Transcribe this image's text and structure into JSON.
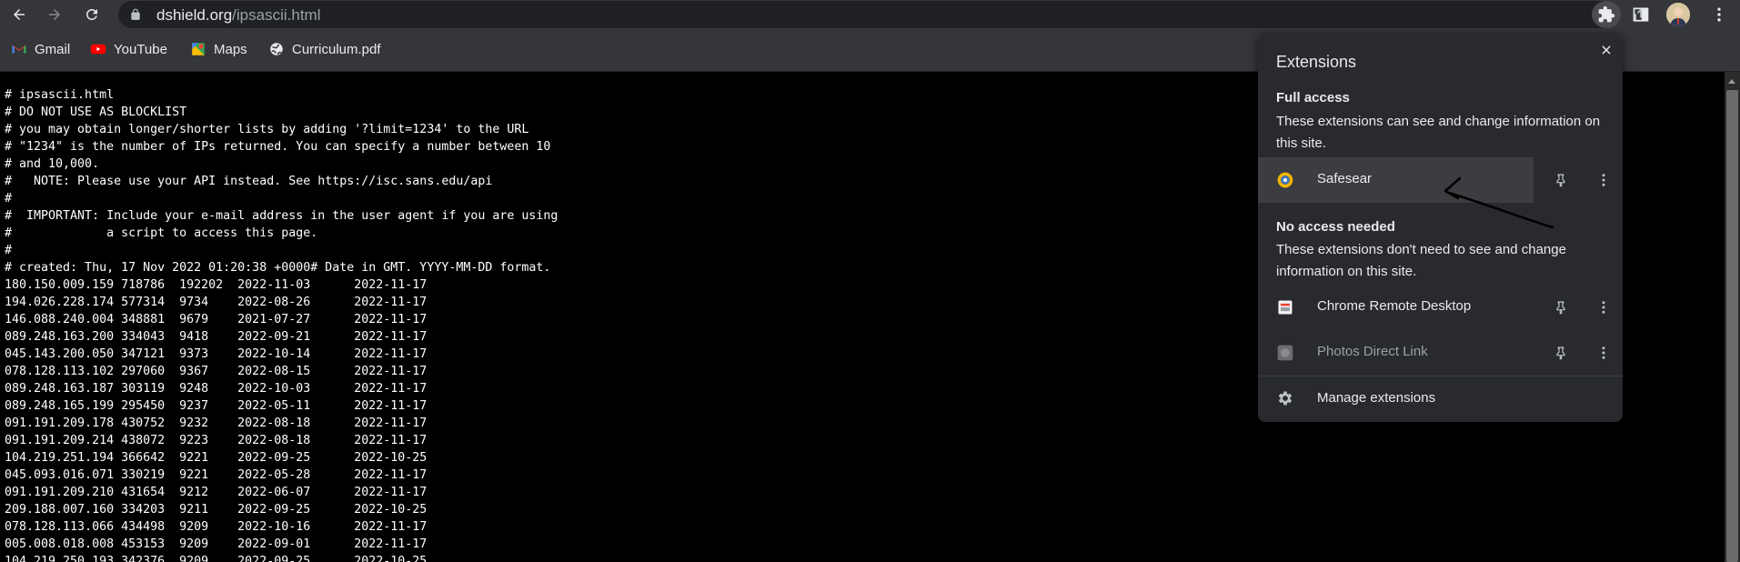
{
  "toolbar": {
    "url_host": "dshield.org",
    "url_path": "/ipsascii.html"
  },
  "bookmarks": [
    {
      "label": "Gmail",
      "icon": "gmail-icon"
    },
    {
      "label": "YouTube",
      "icon": "youtube-icon"
    },
    {
      "label": "Maps",
      "icon": "maps-icon"
    },
    {
      "label": "Curriculum.pdf",
      "icon": "globe-icon"
    }
  ],
  "page": {
    "lines": [
      "# ipsascii.html",
      "# DO NOT USE AS BLOCKLIST",
      "# you may obtain longer/shorter lists by adding '?limit=1234' to the URL",
      "# \"1234\" is the number of IPs returned. You can specify a number between 10",
      "# and 10,000.",
      "#   NOTE: Please use your API instead. See https://isc.sans.edu/api",
      "#",
      "#  IMPORTANT: Include your e-mail address in the user agent if you are using",
      "#             a script to access this page.",
      "#",
      "# created: Thu, 17 Nov 2022 01:20:38 +0000# Date in GMT. YYYY-MM-DD format.",
      "180.150.009.159 718786  192202  2022-11-03      2022-11-17",
      "194.026.228.174 577314  9734    2022-08-26      2022-11-17",
      "146.088.240.004 348881  9679    2021-07-27      2022-11-17",
      "089.248.163.200 334043  9418    2022-09-21      2022-11-17",
      "045.143.200.050 347121  9373    2022-10-14      2022-11-17",
      "078.128.113.102 297060  9367    2022-08-15      2022-11-17",
      "089.248.163.187 303119  9248    2022-10-03      2022-11-17",
      "089.248.165.199 295450  9237    2022-05-11      2022-11-17",
      "091.191.209.178 430752  9232    2022-08-18      2022-11-17",
      "091.191.209.214 438072  9223    2022-08-18      2022-11-17",
      "104.219.251.194 366642  9221    2022-09-25      2022-10-25",
      "045.093.016.071 330219  9221    2022-05-28      2022-11-17",
      "091.191.209.210 431654  9212    2022-06-07      2022-11-17",
      "209.188.007.160 334203  9211    2022-09-25      2022-10-25",
      "078.128.113.066 434498  9209    2022-10-16      2022-11-17",
      "005.008.018.008 453153  9209    2022-09-01      2022-11-17",
      "104.219.250.193 342376  9209    2022-09-25      2022-10-25"
    ]
  },
  "extensions_popup": {
    "title": "Extensions",
    "full_access": {
      "heading": "Full access",
      "description": "These extensions can see and change information on this site.",
      "items": [
        {
          "name": "Safesear",
          "icon": "safesear-icon"
        }
      ]
    },
    "no_access": {
      "heading": "No access needed",
      "description": "These extensions don't need to see and change information on this site.",
      "items": [
        {
          "name": "Chrome Remote Desktop",
          "icon": "chrome-remote-desktop-icon"
        },
        {
          "name": "Photos Direct Link",
          "icon": "photos-direct-link-icon"
        }
      ]
    },
    "manage_label": "Manage extensions"
  },
  "colors": {
    "toolbar_bg": "#35363a",
    "omnibox_bg": "#202124",
    "popup_bg": "#292a2d",
    "page_bg": "#000000",
    "page_text": "#ffffff"
  }
}
